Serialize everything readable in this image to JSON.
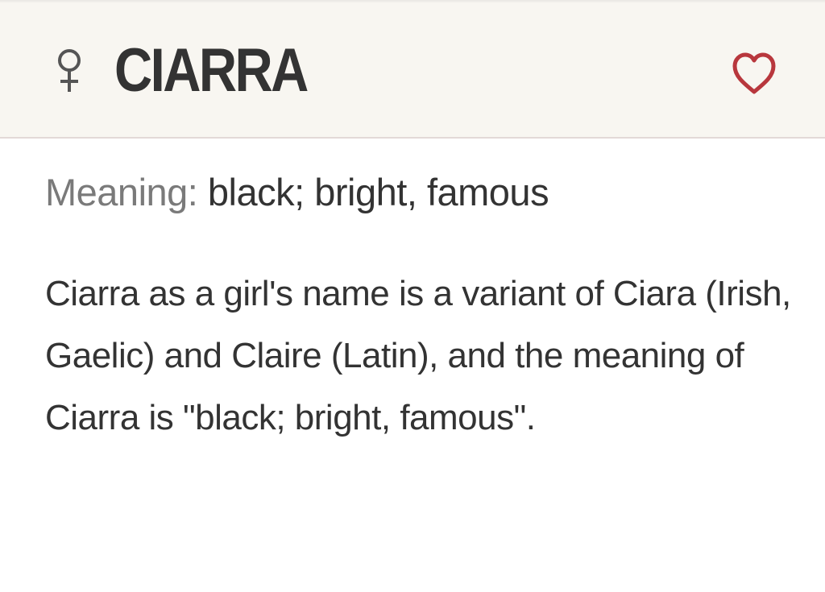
{
  "header": {
    "gender_icon": "female-symbol-icon",
    "name": "CIARRA",
    "favorite_icon": "heart-outline-icon",
    "colors": {
      "background": "#f8f6f1",
      "gender_icon": "#555555",
      "heart": "#b8373d"
    }
  },
  "meaning": {
    "label": "Meaning:",
    "value": " black; bright, famous"
  },
  "description": "Ciarra as a girl's name is a variant of Ciara (Irish, Gaelic) and Claire (Latin), and the meaning of Ciarra is \"black; bright, famous\"."
}
